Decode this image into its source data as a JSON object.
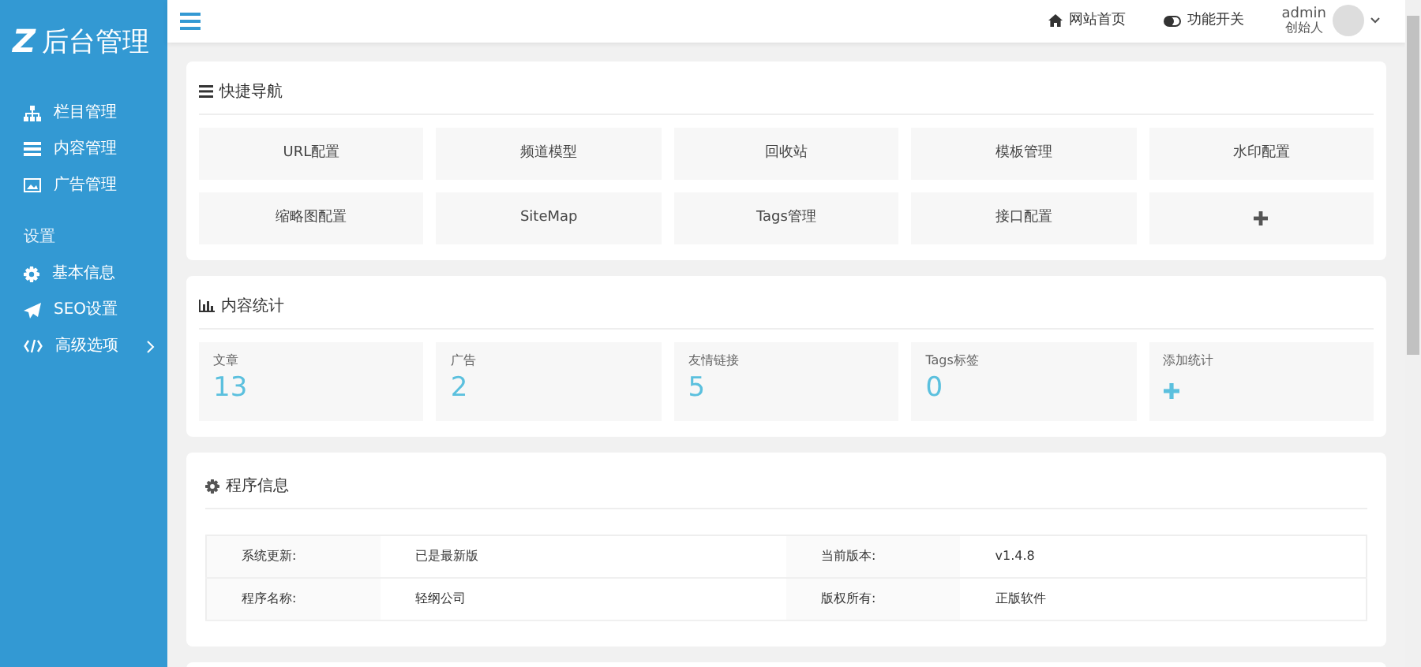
{
  "sidebar": {
    "logo_mark": "Z",
    "logo_text": "后台管理",
    "groups": [
      {
        "items": [
          {
            "label": "栏目管理",
            "expandable": false
          },
          {
            "label": "内容管理",
            "expandable": false
          },
          {
            "label": "广告管理",
            "expandable": false
          }
        ]
      },
      {
        "heading": "设置",
        "items": [
          {
            "label": "基本信息",
            "expandable": false
          },
          {
            "label": "SEO设置",
            "expandable": false
          },
          {
            "label": "高级选项",
            "expandable": true
          }
        ]
      }
    ]
  },
  "topbar": {
    "links": [
      {
        "label": "网站首页"
      },
      {
        "label": "功能开关"
      }
    ],
    "user": {
      "name": "admin",
      "role": "创始人"
    }
  },
  "quick_nav": {
    "title": "快捷导航",
    "items": [
      {
        "kind": "text",
        "label": "URL配置"
      },
      {
        "kind": "text",
        "label": "频道模型"
      },
      {
        "kind": "text",
        "label": "回收站"
      },
      {
        "kind": "text",
        "label": "模板管理"
      },
      {
        "kind": "text",
        "label": "水印配置"
      },
      {
        "kind": "text",
        "label": "缩略图配置"
      },
      {
        "kind": "text",
        "label": "SiteMap"
      },
      {
        "kind": "text",
        "label": "Tags管理"
      },
      {
        "kind": "text",
        "label": "接口配置"
      },
      {
        "kind": "add"
      }
    ]
  },
  "stats": {
    "title": "内容统计",
    "items": [
      {
        "kind": "count",
        "label": "文章",
        "value": "13"
      },
      {
        "kind": "count",
        "label": "广告",
        "value": "2"
      },
      {
        "kind": "count",
        "label": "友情链接",
        "value": "5"
      },
      {
        "kind": "count",
        "label": "Tags标签",
        "value": "0"
      },
      {
        "kind": "add",
        "label": "添加统计"
      }
    ]
  },
  "program_info": {
    "title": "程序信息",
    "rows": [
      [
        "系统更新:",
        "已是最新版",
        "当前版本:",
        "v1.4.8"
      ],
      [
        "程序名称:",
        "轻纲公司",
        "版权所有:",
        "正版软件"
      ]
    ]
  }
}
